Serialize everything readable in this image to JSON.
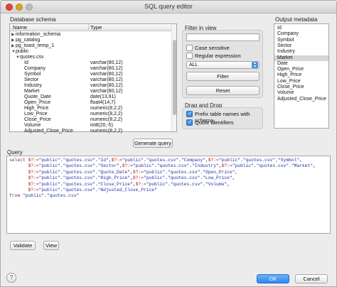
{
  "window": {
    "title": "SQL query editor"
  },
  "schema": {
    "group_label": "Database schema",
    "headers": {
      "name": "Name",
      "type": "Type"
    },
    "rows": [
      {
        "indent": 1,
        "toggle": "▶",
        "name": "information_schema",
        "type": ""
      },
      {
        "indent": 1,
        "toggle": "▶",
        "name": "pg_catalog",
        "type": ""
      },
      {
        "indent": 1,
        "toggle": "▶",
        "name": "pg_toast_temp_1",
        "type": ""
      },
      {
        "indent": 1,
        "toggle": "▼",
        "name": "public",
        "type": ""
      },
      {
        "indent": 2,
        "toggle": "▼",
        "name": "quotes.csv",
        "type": ""
      },
      {
        "indent": 3,
        "toggle": "",
        "name": "Id",
        "type": "varchar(80,12)"
      },
      {
        "indent": 3,
        "toggle": "",
        "name": "Company",
        "type": "varchar(80,12)"
      },
      {
        "indent": 3,
        "toggle": "",
        "name": "Symbol",
        "type": "varchar(80,12)"
      },
      {
        "indent": 3,
        "toggle": "",
        "name": "Sector",
        "type": "varchar(80,12)"
      },
      {
        "indent": 3,
        "toggle": "",
        "name": "Industry",
        "type": "varchar(80,12)"
      },
      {
        "indent": 3,
        "toggle": "",
        "name": "Market",
        "type": "varchar(80,12)"
      },
      {
        "indent": 3,
        "toggle": "",
        "name": "Quote_Date",
        "type": "date(13,91)"
      },
      {
        "indent": 3,
        "toggle": "",
        "name": "Open_Price",
        "type": "float4(14,7)"
      },
      {
        "indent": 3,
        "toggle": "",
        "name": "High_Price",
        "type": "numeric(8,2,2)"
      },
      {
        "indent": 3,
        "toggle": "",
        "name": "Low_Price",
        "type": "numeric(8,2,2)"
      },
      {
        "indent": 3,
        "toggle": "",
        "name": "Close_Price",
        "type": "numeric(8,2,2)"
      },
      {
        "indent": 3,
        "toggle": "",
        "name": "Volume",
        "type": "int8(20,-5)"
      },
      {
        "indent": 3,
        "toggle": "",
        "name": "Adjusted_Close_Price",
        "type": "numeric(8,2,2)"
      }
    ],
    "generate_button": "Generate query"
  },
  "filter": {
    "group_label": "Filter in view",
    "search_value": "",
    "case_sensitive": {
      "label": "Case sensitive",
      "checked": false
    },
    "regex": {
      "label": "Regular expression",
      "checked": false
    },
    "scope_value": "ALL",
    "filter_button": "Filter",
    "reset_button": "Reset"
  },
  "dragdrop": {
    "group_label": "Drag and Drop",
    "prefix": {
      "label": "Prefix table names with schema",
      "checked": true
    },
    "quote": {
      "label": "Quote identifiers",
      "checked": true
    }
  },
  "output_metadata": {
    "group_label": "Output metadata",
    "items": [
      "Id",
      "Company",
      "Symbol",
      "Sector",
      "Industry",
      "Market",
      "Date",
      "Open_Price",
      "High_Price",
      "Low_Price",
      "Close_Price",
      "Volume",
      "Adjusted_Close_Price"
    ],
    "selected": "Market"
  },
  "query": {
    "label": "Query",
    "lines": [
      "select $?:=\"public\".\"quotes.csv\".\"Id\",$?:=\"public\".\"quotes.csv\".\"Company\",$?:=\"public\".\"quotes.csv\".\"Symbol\",",
      "       $?:=\"public\".\"quotes.csv\".\"Sector\",$?:=\"public\".\"quotes.csv\".\"Industry\",$?:=\"public\".\"quotes.csv\".\"Market\",",
      "       $?:=\"public\".\"quotes.csv\".\"Quote_Date\",$?:=\"public\".\"quotes.csv\".\"Open_Price\",",
      "       $?:=\"public\".\"quotes.csv\".\"High_Price\",$?:=\"public\".\"quotes.csv\".\"Low_Price\",",
      "       $?:=\"public\".\"quotes.csv\".\"Close_Price\",$?:=\"public\".\"quotes.csv\".\"Volume\",",
      "       $?:=\"public\".\"quotes.csv\".\"Adjusted_Close_Price\"",
      "from \"public\".\"quotes.csv\""
    ],
    "validate_button": "Validate",
    "view_button": "View"
  },
  "footer": {
    "help": "?",
    "ok_button": "OK",
    "cancel_button": "Cancel"
  }
}
